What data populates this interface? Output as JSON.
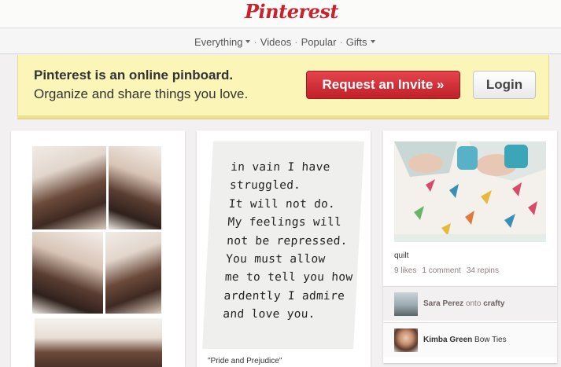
{
  "header": {
    "logo": "Pinterest"
  },
  "nav": {
    "items": [
      "Everything",
      "Videos",
      "Popular",
      "Gifts"
    ]
  },
  "banner": {
    "title": "Pinterest is an online pinboard.",
    "subtitle": "Organize and share things you love.",
    "invite_label": "Request an Invite »",
    "login_label": "Login"
  },
  "pins": {
    "quote_lines": [
      "in vain I have",
      "struggled.",
      "It will not do.",
      "My feelings will",
      "not be repressed.",
      "You must allow",
      "me to tell you how",
      "ardently I admire",
      "and love you."
    ],
    "quote_caption": "\"Pride and Prejudice\"",
    "quilt_title": "quilt",
    "quilt_likes": "9 likes",
    "quilt_comments": "1 comment",
    "quilt_repins": "34 repins",
    "activity": [
      {
        "user": "Sara Perez",
        "connector": "onto",
        "board": "crafty"
      },
      {
        "user": "Kimba Green",
        "connector": "",
        "board": "Bow Ties"
      }
    ]
  },
  "colors": {
    "brand": "#c8232c",
    "banner_bg": "#fcf5b8"
  }
}
